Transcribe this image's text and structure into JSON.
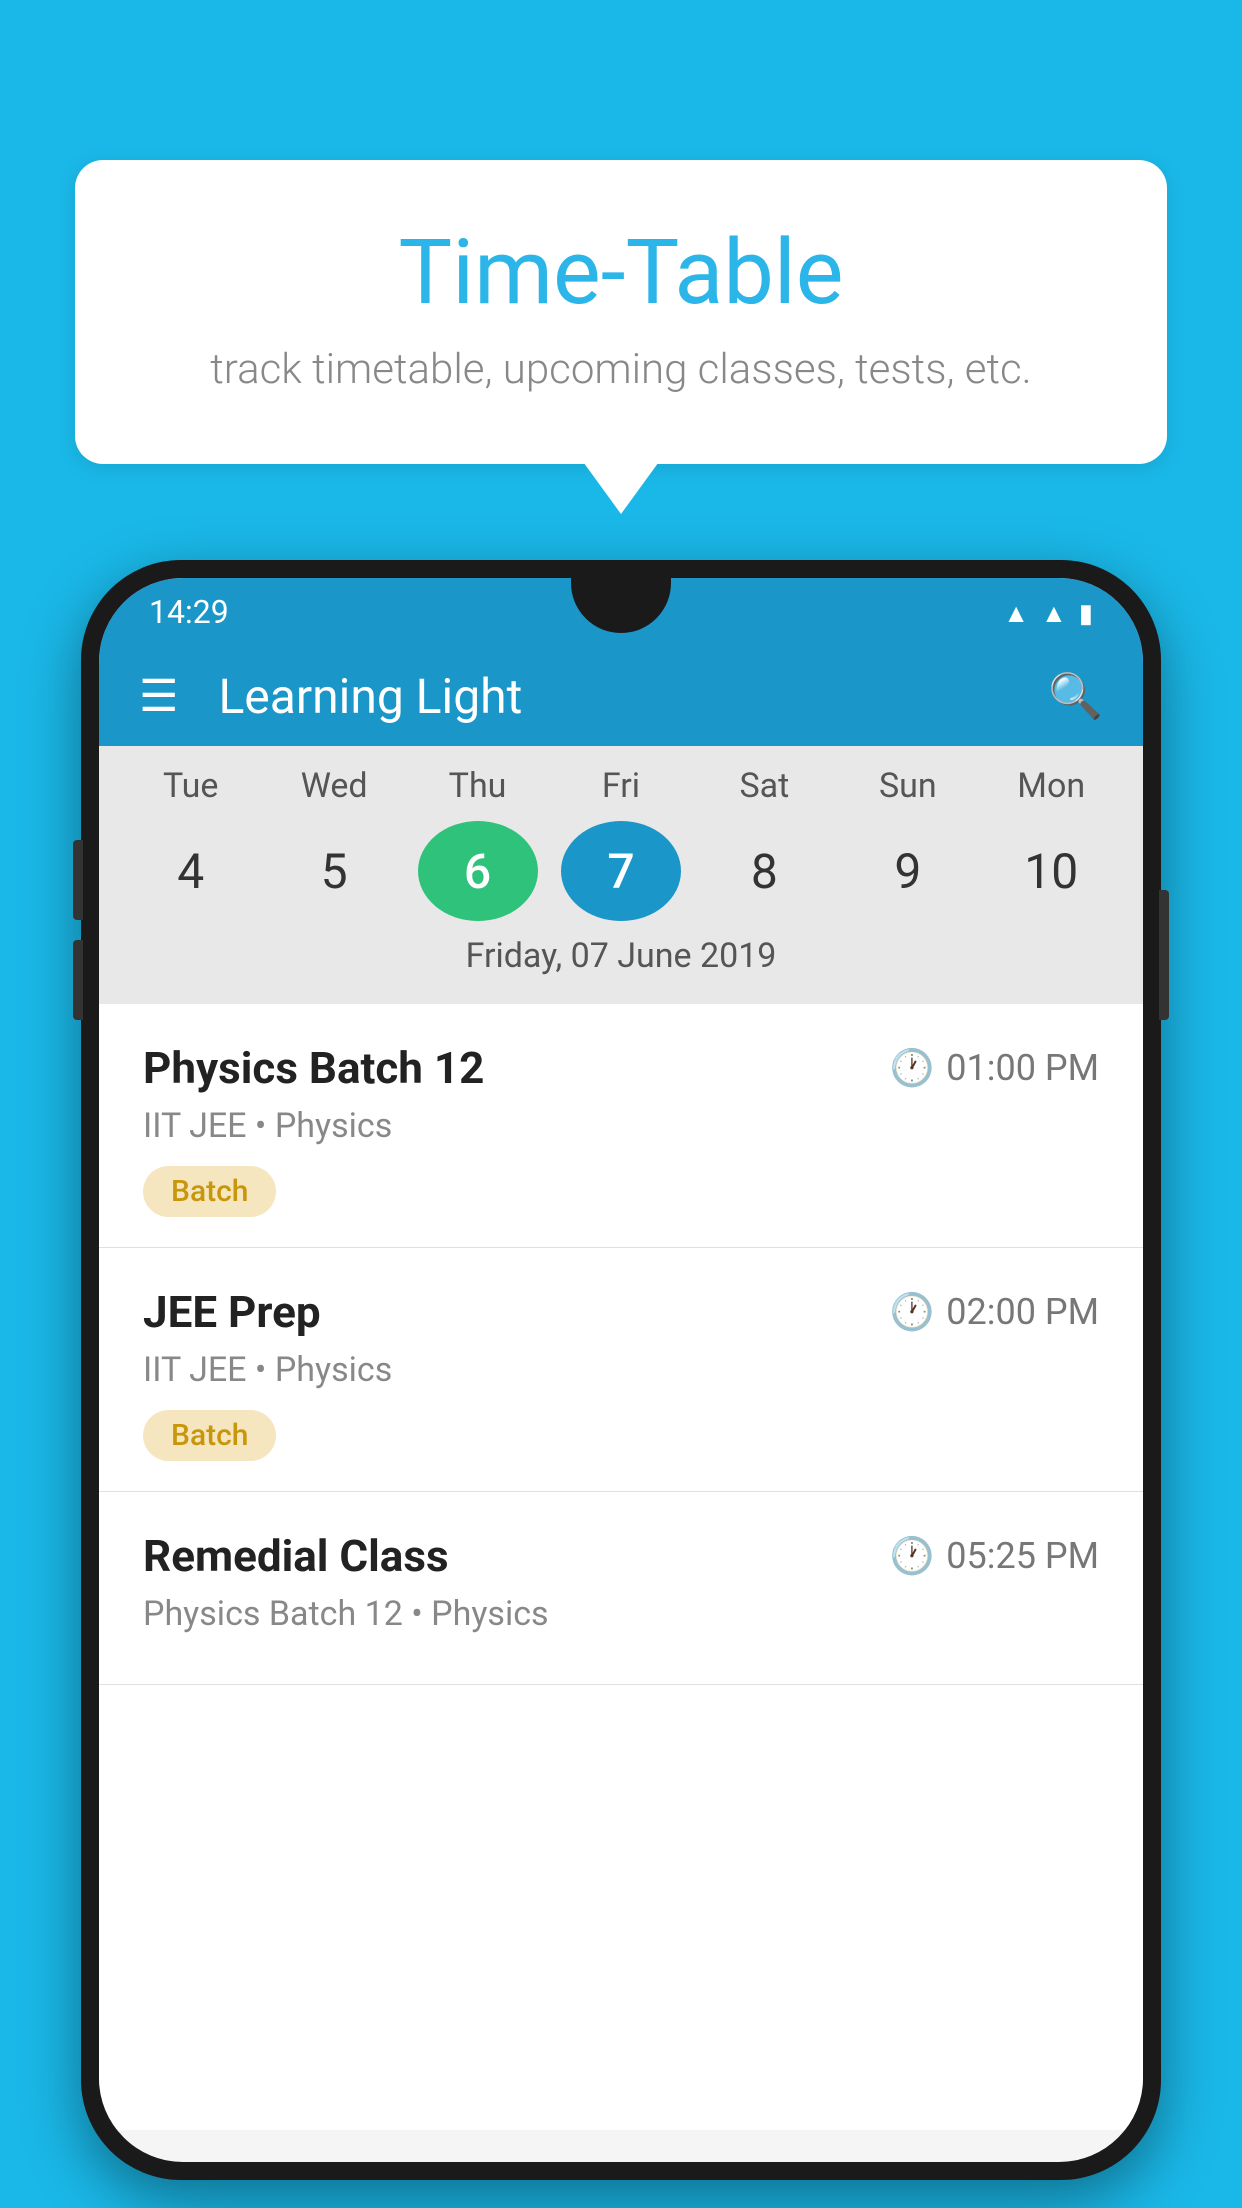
{
  "background_color": "#1ab8e8",
  "speech_bubble": {
    "title": "Time-Table",
    "subtitle": "track timetable, upcoming classes, tests, etc."
  },
  "phone": {
    "status_bar": {
      "time": "14:29"
    },
    "app_header": {
      "title": "Learning Light"
    },
    "calendar": {
      "days": [
        {
          "name": "Tue",
          "number": "4",
          "state": "normal"
        },
        {
          "name": "Wed",
          "number": "5",
          "state": "normal"
        },
        {
          "name": "Thu",
          "number": "6",
          "state": "today"
        },
        {
          "name": "Fri",
          "number": "7",
          "state": "selected"
        },
        {
          "name": "Sat",
          "number": "8",
          "state": "normal"
        },
        {
          "name": "Sun",
          "number": "9",
          "state": "normal"
        },
        {
          "name": "Mon",
          "number": "10",
          "state": "normal"
        }
      ],
      "selected_date_label": "Friday, 07 June 2019"
    },
    "schedule": [
      {
        "title": "Physics Batch 12",
        "time": "01:00 PM",
        "subtitle": "IIT JEE • Physics",
        "badge": "Batch"
      },
      {
        "title": "JEE Prep",
        "time": "02:00 PM",
        "subtitle": "IIT JEE • Physics",
        "badge": "Batch"
      },
      {
        "title": "Remedial Class",
        "time": "05:25 PM",
        "subtitle": "Physics Batch 12 • Physics",
        "badge": null
      }
    ]
  }
}
